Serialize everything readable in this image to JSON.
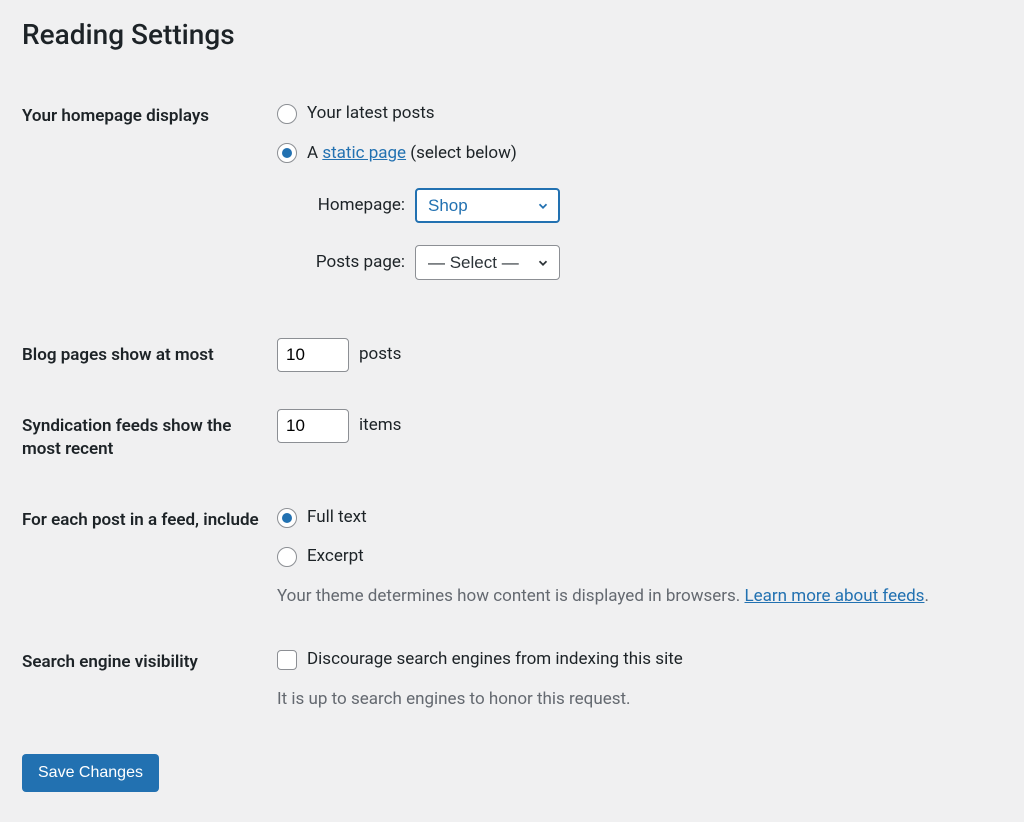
{
  "page": {
    "title": "Reading Settings"
  },
  "homepage": {
    "label": "Your homepage displays",
    "opt_latest": "Your latest posts",
    "opt_static_prefix": "A ",
    "opt_static_link": "static page",
    "opt_static_suffix": " (select below)",
    "homepage_label": "Homepage:",
    "homepage_value": "Shop",
    "postspage_label": "Posts page:",
    "postspage_value": "— Select —"
  },
  "blog_pages": {
    "label": "Blog pages show at most",
    "value": "10",
    "suffix": "posts"
  },
  "syndication": {
    "label": "Syndication feeds show the most recent",
    "value": "10",
    "suffix": "items"
  },
  "feed_content": {
    "label": "For each post in a feed, include",
    "opt_full": "Full text",
    "opt_excerpt": "Excerpt",
    "note_text": "Your theme determines how content is displayed in browsers. ",
    "note_link": "Learn more about feeds",
    "note_period": "."
  },
  "search_visibility": {
    "label": "Search engine visibility",
    "checkbox_label": "Discourage search engines from indexing this site",
    "note": "It is up to search engines to honor this request."
  },
  "submit": {
    "label": "Save Changes"
  }
}
